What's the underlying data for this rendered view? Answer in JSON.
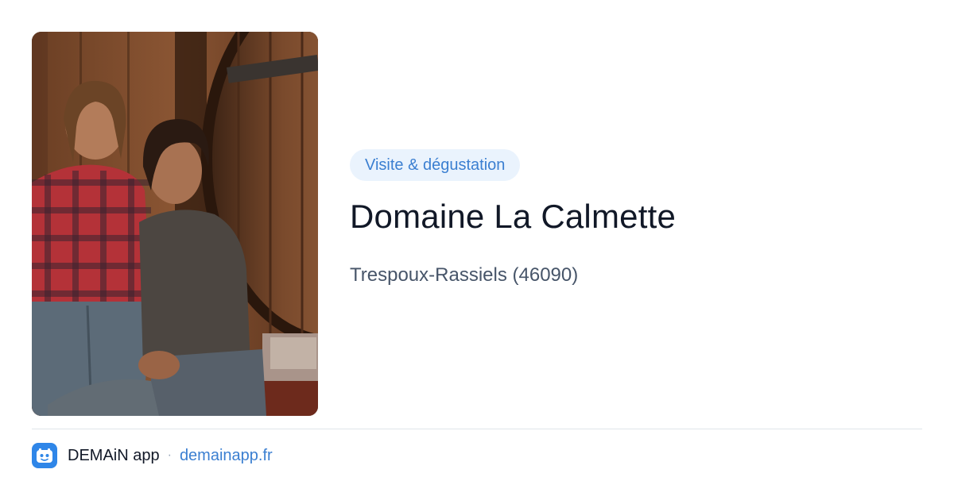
{
  "card": {
    "badge": "Visite & dégustation",
    "title": "Domaine La Calmette",
    "location": "Trespoux-Rassiels (46090)"
  },
  "photo": {
    "subject": "winemakers-photo"
  },
  "footer": {
    "app_icon": "demain-app-icon",
    "app_name": "DEMAiN app",
    "separator": "·",
    "url": "demainapp.fr"
  },
  "colors": {
    "accent": "#3b7fd1",
    "badge_bg": "#eaf3fd",
    "title": "#111827",
    "subtitle": "#475569",
    "app_icon_bg": "#2f86e8"
  }
}
